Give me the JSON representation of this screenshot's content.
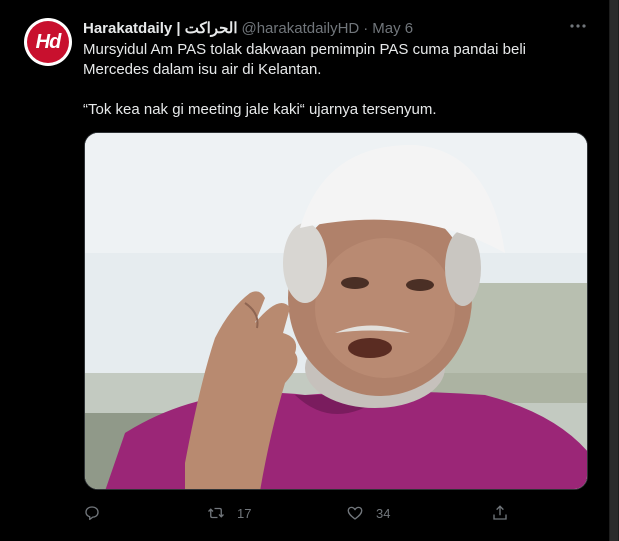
{
  "tweet": {
    "avatar_text": "Hd",
    "display_name": "Harakatdaily | الحراكت",
    "handle": "@harakatdailyHD",
    "separator": "·",
    "date": "May 6",
    "lines": [
      "Mursyidul Am PAS tolak dakwaan pemimpin PAS cuma pandai beli",
      "Mercedes dalam isu air di Kelantan.",
      "“Tok kea nak gi meeting jale kaki“ ujarnya tersenyum."
    ],
    "actions": {
      "reply_count": "",
      "retweet_count": "17",
      "like_count": "34"
    },
    "icons": {
      "more": "more-dots-icon",
      "reply": "reply-icon",
      "retweet": "retweet-icon",
      "like": "heart-icon",
      "share": "share-icon"
    },
    "colors": {
      "background": "#000000",
      "text": "#e7e9ea",
      "muted": "#71767b",
      "avatar_red": "#c8102e",
      "robe": "#a1287a",
      "cap": "#f5f5f5"
    }
  }
}
